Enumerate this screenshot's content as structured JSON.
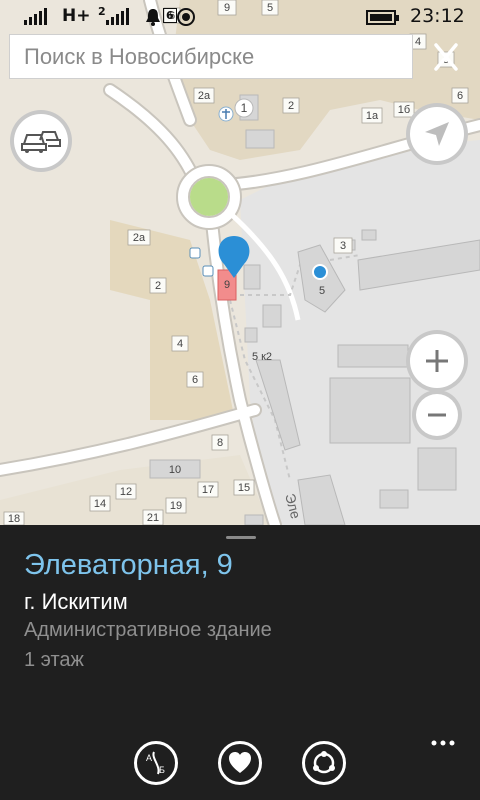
{
  "status_bar": {
    "network_type": "H+",
    "sim2": "2",
    "notif_count": "6",
    "time": "23:12"
  },
  "search": {
    "placeholder": "Поиск в Новосибирске"
  },
  "map": {
    "labels": {
      "l_9": "9",
      "l_6top": "6",
      "l_5top": "5",
      "l_4r": "4",
      "l_5r": "5",
      "l_2a_top": "2а",
      "l_1": "1",
      "l_2top": "2",
      "l_1a": "1а",
      "l_1b": "1б",
      "l_6r": "6",
      "l_2a_left": "2а",
      "l_3": "3",
      "l_2": "2",
      "l_9b": "9",
      "l_5": "5",
      "l_4": "4",
      "l_6": "6",
      "l_5k2": "5 к2",
      "l_8": "8",
      "l_10": "10",
      "l_12": "12",
      "l_14": "14",
      "l_17": "17",
      "l_15": "15",
      "l_19": "19",
      "l_21": "21",
      "l_18": "18",
      "street": "Эле"
    }
  },
  "place": {
    "title": "Элеваторная, 9",
    "city": "г. Искитим",
    "type": "Административное здание",
    "floors": "1 этаж"
  },
  "actions": {
    "route_icon_text_a": "А",
    "route_icon_text_b": "Б",
    "more_label": "..."
  },
  "colors": {
    "accent": "#7ec4ec",
    "pin": "#2b8fd6",
    "panel": "#1f1f1f",
    "map_land": "#ebe6dc",
    "map_block": "#e2d8c2",
    "map_industrial": "#e4e4e4",
    "roundabout": "#b9dc8a"
  }
}
